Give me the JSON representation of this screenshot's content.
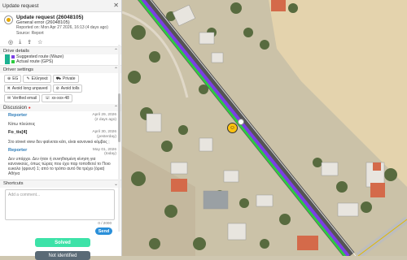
{
  "panel": {
    "title": "Update request",
    "header": {
      "title": "Update request (26048105)",
      "subtitle": "General error (26048105)",
      "reported": "Reported on: Mon Apr 27 2026, 16:13 (4 days ago)",
      "source": "Source: Report"
    },
    "icons": [
      "location-icon",
      "download-icon",
      "share-icon",
      "star-icon"
    ],
    "drive_details": {
      "label": "Drive details",
      "routes": [
        {
          "label": "Suggested route (Waze)",
          "color": "#7b3fe4"
        },
        {
          "label": "Actual route (GPS)",
          "color": "#2ecc40"
        }
      ]
    },
    "driver_settings": {
      "label": "Driver settings",
      "buttons": [
        "EG",
        "Ελληνικά",
        "Private",
        "Avoid long unpaved",
        "Avoid tolls",
        "Verified email",
        "xx-xxx-48"
      ]
    },
    "discussion": {
      "label": "Discussion",
      "messages": [
        {
          "name": "Reporter",
          "date": "April 29, 2026",
          "ago": "(2 days ago)",
          "text": "Κάτω πλεύσεις"
        },
        {
          "name": "Fo_tis[4]",
          "date": "April 30, 2026",
          "ago": "(yesterday)",
          "text": "Στο street view δεν φαίνεται κάτι, είναι κανονικό κόμβος ;"
        },
        {
          "name": "Reporter",
          "date": "May 01, 2026",
          "ago": "(today)",
          "text": "Δεν υπάρχει. Δεν ήταν ή συνηθισμένη κίνηση για κανονικούς, όπως τώρας που έχει παρ τοποθετεί το Ποιο ευκολο (φρουτ) 1; από το τρόπο αυτό θα τρέχει (όρια) Αθήνα"
        }
      ]
    },
    "shortcuts": {
      "label": "Shortcuts"
    },
    "comment": {
      "placeholder": "Add a comment...",
      "count": "0 / 2000",
      "send": "Send"
    },
    "actions": {
      "solved": "Solved",
      "not_identified": "Not identified"
    }
  }
}
